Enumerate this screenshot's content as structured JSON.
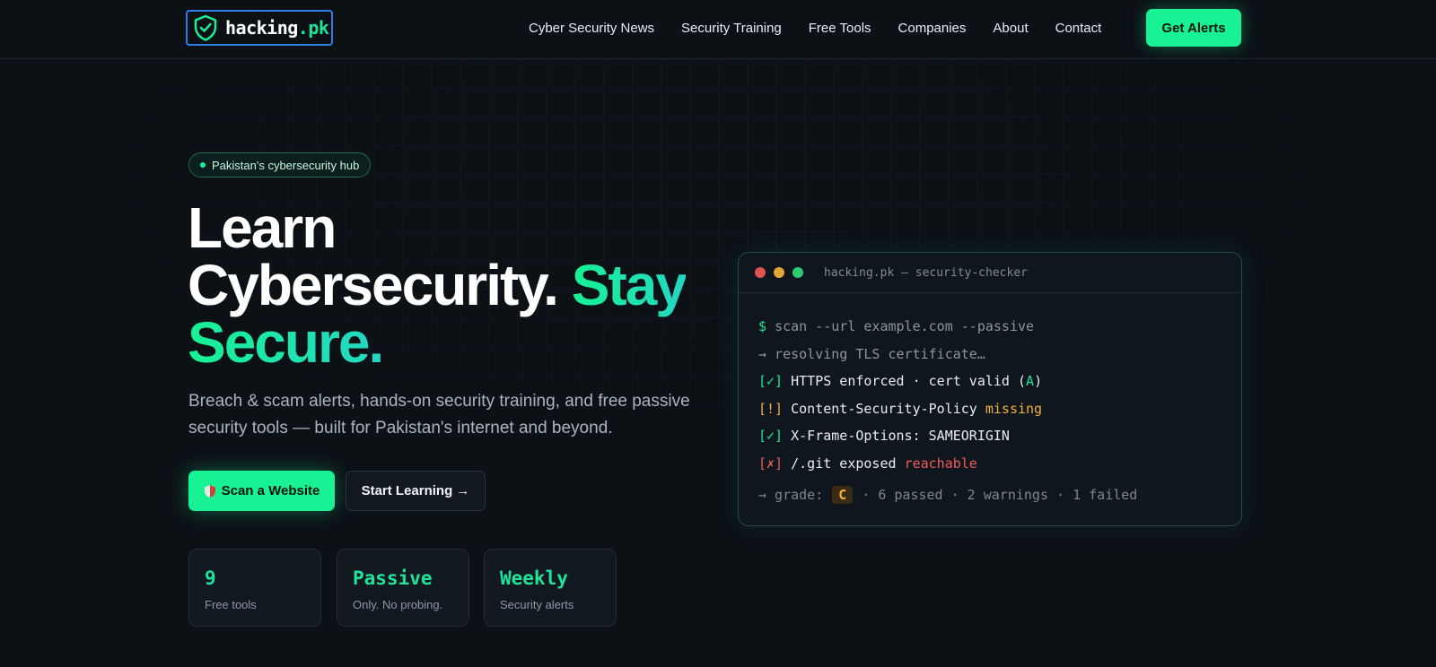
{
  "nav": {
    "logo_text": "hacking",
    "logo_accent": ".pk",
    "links": [
      "Cyber Security News",
      "Security Training",
      "Free Tools",
      "Companies",
      "About",
      "Contact"
    ],
    "cta": "Get Alerts"
  },
  "hero": {
    "pill": "Pakistan's cybersecurity hub",
    "headline_line1": "Learn",
    "headline_line2": "Cybersecurity.",
    "headline_accent1": "Stay",
    "headline_accent2": "Secure.",
    "subtext": "Breach & scam alerts, hands-on security training, and free passive security tools — built for Pakistan's internet and beyond.",
    "scan_button": "Scan a Website",
    "learn_button": "Start Learning →"
  },
  "stats": [
    {
      "value": "9",
      "label": "Free tools"
    },
    {
      "value": "Passive",
      "label": "Only. No probing."
    },
    {
      "value": "Weekly",
      "label": "Security alerts"
    }
  ],
  "terminal": {
    "title": "hacking.pk — security-checker",
    "prompt": "$",
    "command": "scan --url example.com --passive",
    "resolving": "→ resolving TLS certificate…",
    "line_https_tag": "[✓]",
    "line_https_text": "HTTPS enforced · cert valid (",
    "line_https_grade": "A",
    "line_https_end": ")",
    "line_csp_tag": "[!]",
    "line_csp_text": "Content-Security-Policy ",
    "line_csp_status": "missing",
    "line_xfo_tag": "[✓]",
    "line_xfo_text": "X-Frame-Options: SAMEORIGIN",
    "line_git_tag": "[✗]",
    "line_git_text": "/.git exposed ",
    "line_git_status": "reachable",
    "grade_prefix": "→ grade:",
    "grade": "C",
    "grade_summary": "· 6 passed · 2 warnings · 1 failed"
  },
  "colors": {
    "accent": "#17f294",
    "accent_teal": "#24d6c4",
    "background": "#0c1116",
    "warning": "#f0b03c",
    "error": "#ef5b5b",
    "dot_red": "#e05252",
    "dot_amber": "#e3a33b",
    "dot_green": "#2ecc71"
  },
  "icons": {
    "logo": "shield-check-icon",
    "scan_button": "shield-icon"
  }
}
